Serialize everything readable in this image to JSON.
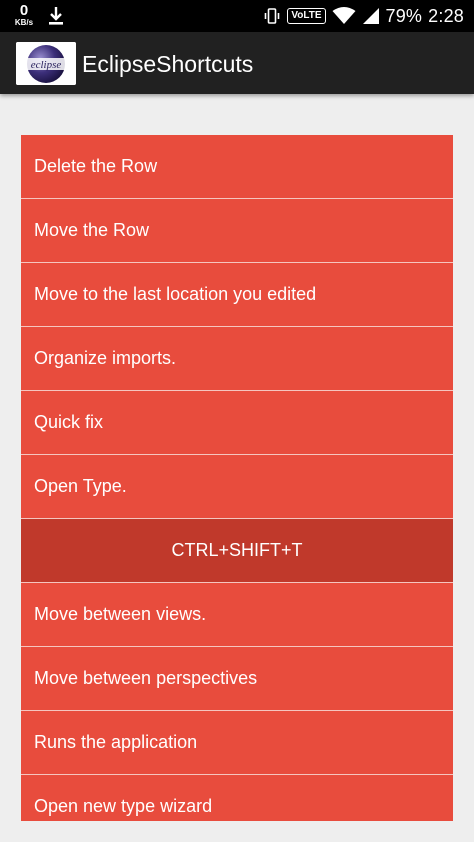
{
  "status_bar": {
    "speed_value": "0",
    "speed_unit": "KB/s",
    "volte": "VoLTE",
    "battery": "79%",
    "time": "2:28"
  },
  "app_bar": {
    "logo_text": "eclipse",
    "title": "EclipseShortcuts"
  },
  "shortcuts": [
    {
      "label": "Delete the Row"
    },
    {
      "label": "Move the Row"
    },
    {
      "label": "Move to the last location you edited"
    },
    {
      "label": "Organize imports."
    },
    {
      "label": "Quick fix"
    },
    {
      "label": "Open Type."
    },
    {
      "label": "CTRL+SHIFT+T",
      "expanded_detail": true
    },
    {
      "label": "Move between views."
    },
    {
      "label": "Move between perspectives"
    },
    {
      "label": "Runs the application"
    },
    {
      "label": "Open new type wizard"
    }
  ],
  "colors": {
    "row": "#e84c3d",
    "detail_row": "#c0392b",
    "app_bar": "#212121",
    "background": "#eeeeee"
  }
}
